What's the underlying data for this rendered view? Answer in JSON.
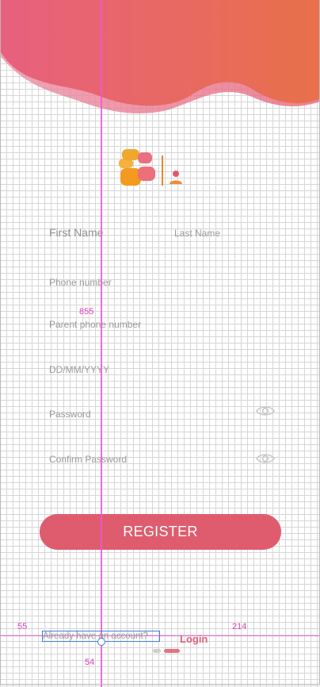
{
  "form": {
    "first_name_placeholder": "First Name",
    "last_name_placeholder": "Last Name",
    "phone_placeholder": "Phone number",
    "parent_phone_placeholder": "Parent phone number",
    "dob_placeholder": "DD/MM/YYYY",
    "password_placeholder": "Password",
    "confirm_password_placeholder": "Confirm Password",
    "register_label": "REGISTER"
  },
  "footer": {
    "already_text": "Already have an account?",
    "login_label": "Login",
    "page_indicator": {
      "count": 2,
      "active_index": 1
    }
  },
  "overlay": {
    "label_855": "855",
    "label_55": "55",
    "label_214": "214",
    "label_54": "54"
  },
  "colors": {
    "accent": "#df5c6e",
    "header_start": "#e86f8a",
    "header_end": "#e8704a",
    "guide": "#ee55d7",
    "selection": "#3d7fe0"
  },
  "icons": {
    "password_toggle": "eye-icon",
    "confirm_password_toggle": "eye-icon",
    "logo": "app-logo-icon"
  }
}
